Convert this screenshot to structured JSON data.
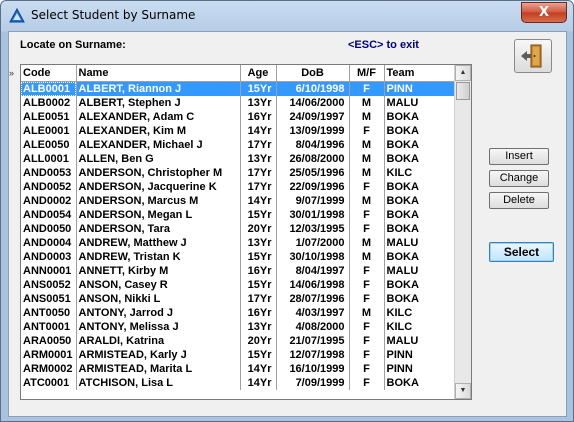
{
  "window": {
    "title": "Select Student by Surname",
    "close_label": "X"
  },
  "search": {
    "label": "Locate on Surname:",
    "esc_hint": "<ESC> to exit"
  },
  "grid": {
    "marker": "»",
    "columns": [
      "Code",
      "Name",
      "Age",
      "DoB",
      "M/F",
      "Team"
    ],
    "rows": [
      [
        "ALB0001",
        "ALBERT, Riannon J",
        "15Yr",
        "6/10/1998",
        "F",
        "PINN"
      ],
      [
        "ALB0002",
        "ALBERT, Stephen J",
        "13Yr",
        "14/06/2000",
        "M",
        "MALU"
      ],
      [
        "ALE0051",
        "ALEXANDER, Adam C",
        "16Yr",
        "24/09/1997",
        "M",
        "BOKA"
      ],
      [
        "ALE0001",
        "ALEXANDER, Kim M",
        "14Yr",
        "13/09/1999",
        "F",
        "BOKA"
      ],
      [
        "ALE0050",
        "ALEXANDER, Michael J",
        "17Yr",
        "8/04/1996",
        "M",
        "BOKA"
      ],
      [
        "ALL0001",
        "ALLEN, Ben G",
        "13Yr",
        "26/08/2000",
        "M",
        "BOKA"
      ],
      [
        "AND0053",
        "ANDERSON, Christopher M",
        "17Yr",
        "25/05/1996",
        "M",
        "KILC"
      ],
      [
        "AND0052",
        "ANDERSON, Jacquerine K",
        "17Yr",
        "22/09/1996",
        "F",
        "BOKA"
      ],
      [
        "AND0002",
        "ANDERSON, Marcus M",
        "14Yr",
        "9/07/1999",
        "M",
        "BOKA"
      ],
      [
        "AND0054",
        "ANDERSON, Megan L",
        "15Yr",
        "30/01/1998",
        "F",
        "BOKA"
      ],
      [
        "AND0050",
        "ANDERSON, Tara",
        "20Yr",
        "12/03/1995",
        "F",
        "BOKA"
      ],
      [
        "AND0004",
        "ANDREW, Matthew J",
        "13Yr",
        "1/07/2000",
        "M",
        "MALU"
      ],
      [
        "AND0003",
        "ANDREW, Tristan K",
        "15Yr",
        "30/10/1998",
        "M",
        "BOKA"
      ],
      [
        "ANN0001",
        "ANNETT, Kirby M",
        "16Yr",
        "8/04/1997",
        "F",
        "MALU"
      ],
      [
        "ANS0052",
        "ANSON, Casey R",
        "15Yr",
        "14/06/1998",
        "F",
        "BOKA"
      ],
      [
        "ANS0051",
        "ANSON, Nikki L",
        "17Yr",
        "28/07/1996",
        "F",
        "BOKA"
      ],
      [
        "ANT0050",
        "ANTONY, Jarrod J",
        "16Yr",
        "4/03/1997",
        "M",
        "KILC"
      ],
      [
        "ANT0001",
        "ANTONY, Melissa J",
        "13Yr",
        "4/08/2000",
        "F",
        "KILC"
      ],
      [
        "ARA0050",
        "ARALDI, Katrina",
        "20Yr",
        "21/07/1995",
        "F",
        "MALU"
      ],
      [
        "ARM0001",
        "ARMISTEAD, Karly J",
        "15Yr",
        "12/07/1998",
        "F",
        "PINN"
      ],
      [
        "ARM0002",
        "ARMISTEAD, Marita L",
        "14Yr",
        "16/10/1999",
        "F",
        "PINN"
      ],
      [
        "ATC0001",
        "ATCHISON, Lisa L",
        "14Yr",
        "7/09/1999",
        "F",
        "BOKA"
      ]
    ]
  },
  "buttons": {
    "insert": "Insert",
    "change": "Change",
    "delete": "Delete",
    "select": "Select"
  },
  "colors": {
    "selection": "#3399ff",
    "esc_hint": "#000080",
    "close": "#c23d1f"
  },
  "icons": {
    "app": "triangle-app-icon",
    "exit": "exit-door-icon"
  }
}
